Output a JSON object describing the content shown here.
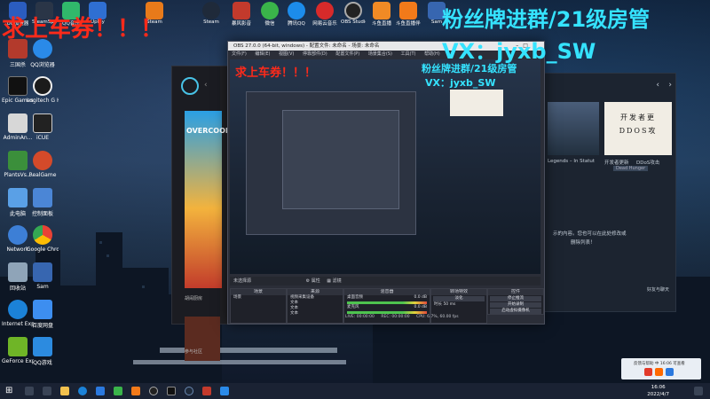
{
  "overlay": {
    "promo_red": "求上车券！！！",
    "promo_red_small": "求上车券！！！",
    "group_cyan": "粉丝牌进群/21级房管",
    "group_cyan_small": "粉丝牌进群/21级房管",
    "wechat_cyan": "VX：jyxb_SW",
    "wechat_cyan_small": "VX：jyxb_SW"
  },
  "desktop_icons": [
    {
      "label": "三国杀",
      "color": "#b33a2c"
    },
    {
      "label": "QQ浏览器",
      "color": "#2a8ae8"
    },
    {
      "label": "Epic Games Launcher",
      "color": "#111111"
    },
    {
      "label": "Logitech G HUB",
      "color": "#1b1b1b"
    },
    {
      "label": "AdminAn...",
      "color": "#d7d7d7"
    },
    {
      "label": "iCUE",
      "color": "#222222"
    },
    {
      "label": "PlantsVs...",
      "color": "#3b8f3b"
    },
    {
      "label": "RealGame",
      "color": "#d44a2a"
    },
    {
      "label": "此电脑",
      "color": "#5aa0e6"
    },
    {
      "label": "控制面板",
      "color": "#4b86d6"
    },
    {
      "label": "Network",
      "color": "#3d7fd6"
    },
    {
      "label": "Google Chrome",
      "color": "#e8e8e8"
    },
    {
      "label": "回收站",
      "color": "#8fa4b8"
    },
    {
      "label": "Sam",
      "color": "#3766b0"
    },
    {
      "label": "Internet Explorer",
      "color": "#1b82d8"
    },
    {
      "label": "百度网盘",
      "color": "#3d8ef0"
    },
    {
      "label": "GeForce Experience",
      "color": "#6fb527"
    },
    {
      "label": "QQ游戏",
      "color": "#2c8be0"
    }
  ],
  "top_icons": [
    {
      "label": "UU加速器",
      "color": "#2b5dbf"
    },
    {
      "label": "SteamSpeed",
      "color": "#2a3547"
    },
    {
      "label": "QQ音乐",
      "color": "#30b86b"
    },
    {
      "label": "Uplay",
      "color": "#2f6fd2"
    },
    {
      "label": "Steam",
      "color": "#1f2a3a"
    },
    {
      "label": "暴风影音",
      "color": "#c33a2c"
    },
    {
      "label": "腾讯会议",
      "color": "#2b79de"
    },
    {
      "label": "微信",
      "color": "#3ab44a"
    },
    {
      "label": "腾讯QQ",
      "color": "#1c8cea"
    },
    {
      "label": "网易云音乐",
      "color": "#d72a2a"
    },
    {
      "label": "OBS Studio",
      "color": "#222222"
    },
    {
      "label": "斗鱼直播",
      "color": "#f08a25"
    },
    {
      "label": "斗鱼直播伴侣",
      "color": "#f27a1a"
    },
    {
      "label": "Sam",
      "color": "#3766b0"
    }
  ],
  "obs": {
    "title": "OBS 27.0.0 (64-bit, windows) - 配置文件: 未命名 - 场景: 未命名",
    "menu": [
      "文件(F)",
      "编辑(E)",
      "视图(V)",
      "停靠部件(D)",
      "配置文件(P)",
      "场景集合(S)",
      "工具(T)",
      "帮助(H)"
    ],
    "scene_bar": "未选择源",
    "properties_btn": "属性",
    "filters_btn": "滤镜",
    "docks": {
      "scenes": {
        "title": "场景",
        "items": [
          "场景"
        ]
      },
      "sources": {
        "title": "来源",
        "items": [
          "视频采集设备",
          "文本",
          "文本",
          "文本",
          "窗口采集",
          "文本"
        ]
      },
      "mixer": {
        "title": "混音器",
        "tracks": [
          "桌面音频",
          "麦克风"
        ],
        "db": [
          "0.0 dB",
          "0.0 dB"
        ]
      },
      "transitions": {
        "title": "转场特效",
        "type": "淡化",
        "duration_label": "时长",
        "duration": "50 ms"
      },
      "controls": {
        "title": "控件",
        "buttons": [
          "停止推流",
          "开始录制",
          "启动虚拟摄像机",
          "工作室模式",
          "设置",
          "退出"
        ]
      }
    },
    "status": {
      "live": "LIVE: 00:00:00",
      "rec": "REC: 00:00:00",
      "cpu": "CPU: 6.7%, 60.00 fps",
      "kbps": "kb/s: 1 (丢弃帧数)"
    }
  },
  "epic": {
    "game": "OVERCOOKED",
    "caption": "胡闹厨房",
    "side_text": "参与社区"
  },
  "steam": {
    "card_text_1": "开发者更",
    "card_text_2": "DDOS攻",
    "labels": [
      "Legends – In Statut",
      "开发者更新",
      "DDoS攻击"
    ],
    "button": "Dead Hunger",
    "notice": "示的内容。您也可以在此处修改或",
    "notice_2": "删除列表！",
    "corner": "好友与聊天"
  },
  "taskbar": {
    "time": "16:06",
    "date": "2022/4/7",
    "notify_text": "反馈与帮助 中 16:06 可查看"
  }
}
